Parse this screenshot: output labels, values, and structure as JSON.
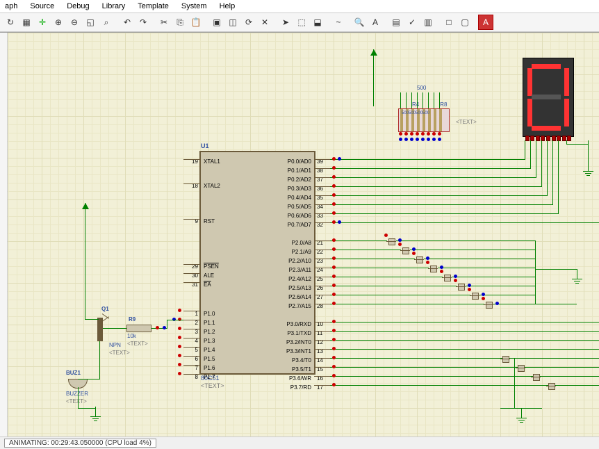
{
  "menu": {
    "items": [
      "aph",
      "Source",
      "Debug",
      "Library",
      "Template",
      "System",
      "Help"
    ]
  },
  "u1": {
    "ref": "U1",
    "value": "80C51",
    "text": "<TEXT>",
    "left_pins": [
      {
        "num": "19",
        "name": "XTAL1"
      },
      {
        "num": "18",
        "name": "XTAL2"
      },
      {
        "num": "9",
        "name": "RST"
      },
      {
        "num": "29",
        "name": "PSEN",
        "ov": true
      },
      {
        "num": "30",
        "name": "ALE"
      },
      {
        "num": "31",
        "name": "EA",
        "ov": true
      },
      {
        "num": "1",
        "name": "P1.0"
      },
      {
        "num": "2",
        "name": "P1.1"
      },
      {
        "num": "3",
        "name": "P1.2"
      },
      {
        "num": "4",
        "name": "P1.3"
      },
      {
        "num": "5",
        "name": "P1.4"
      },
      {
        "num": "6",
        "name": "P1.5"
      },
      {
        "num": "7",
        "name": "P1.6"
      },
      {
        "num": "8",
        "name": "P1.7"
      }
    ],
    "right_pins": [
      {
        "num": "39",
        "name": "P0.0/AD0"
      },
      {
        "num": "38",
        "name": "P0.1/AD1"
      },
      {
        "num": "37",
        "name": "P0.2/AD2"
      },
      {
        "num": "36",
        "name": "P0.3/AD3"
      },
      {
        "num": "35",
        "name": "P0.4/AD4"
      },
      {
        "num": "34",
        "name": "P0.5/AD5"
      },
      {
        "num": "33",
        "name": "P0.6/AD6"
      },
      {
        "num": "32",
        "name": "P0.7/AD7"
      },
      {
        "num": "21",
        "name": "P2.0/A8"
      },
      {
        "num": "22",
        "name": "P2.1/A9"
      },
      {
        "num": "23",
        "name": "P2.2/A10"
      },
      {
        "num": "24",
        "name": "P2.3/A11"
      },
      {
        "num": "25",
        "name": "P2.4/A12"
      },
      {
        "num": "26",
        "name": "P2.5/A13"
      },
      {
        "num": "27",
        "name": "P2.6/A14"
      },
      {
        "num": "28",
        "name": "P2.7/A15"
      },
      {
        "num": "10",
        "name": "P3.0/RXD"
      },
      {
        "num": "11",
        "name": "P3.1/TXD"
      },
      {
        "num": "12",
        "name": "P3.2/INT0",
        "ov": true
      },
      {
        "num": "13",
        "name": "P3.3/INT1",
        "ov": true
      },
      {
        "num": "14",
        "name": "P3.4/T0"
      },
      {
        "num": "15",
        "name": "P3.5/T1"
      },
      {
        "num": "16",
        "name": "P3.6/WR",
        "ov": true
      },
      {
        "num": "17",
        "name": "P3.7/RD",
        "ov": true
      }
    ]
  },
  "q1": {
    "ref": "Q1",
    "value": "NPN",
    "text": "<TEXT>"
  },
  "r9": {
    "ref": "R9",
    "value": "10k",
    "text": "<TEXT>"
  },
  "buz": {
    "ref": "BUZ1",
    "value": "BUZZER",
    "text": "<TEXT>"
  },
  "rnet": {
    "ref1": "R4",
    "ref2": "R8",
    "val": "500",
    "text": "<TEXT>"
  },
  "rnet_top": "500",
  "status": {
    "text": "ANIMATING: 00:29:43.050000 (CPU load 4%)"
  }
}
